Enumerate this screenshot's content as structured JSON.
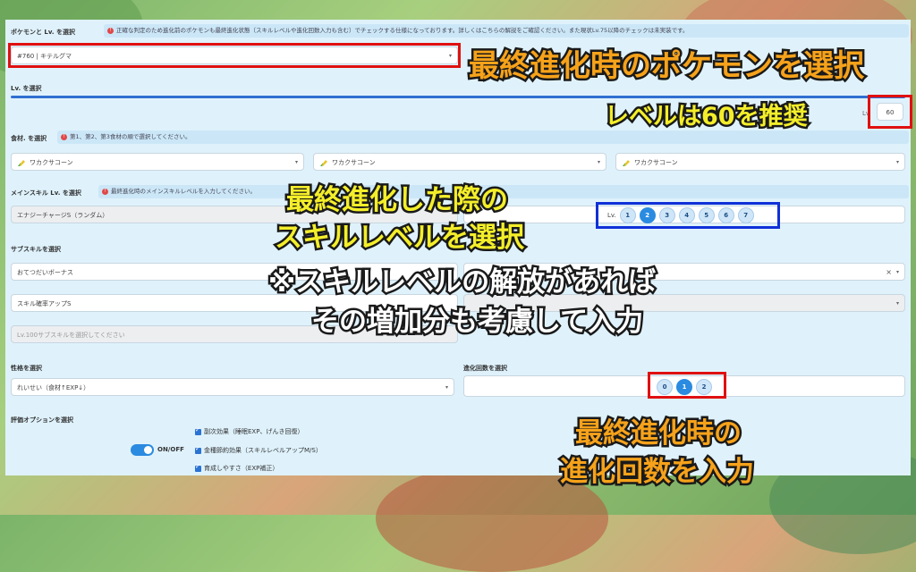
{
  "pokemon": {
    "label": "ポケモンと Lv. を選択",
    "note": "正確な判定のため進化前のポケモンも最終進化状態（スキルレベルや進化回数入力も含む）でチェックする仕様になっております。詳しくはこちらの解説をご確認ください。また現状Lv.75以降のチェックは未実装です。",
    "selected": "#760 | キテルグマ"
  },
  "level": {
    "label": "Lv. を選択",
    "prefix": "Lv.",
    "value": "60"
  },
  "ingredients": {
    "label": "食材. を選択",
    "note": "第1、第2、第3食材の順で選択してください。",
    "items": [
      "ワカクサコーン",
      "ワカクサコーン",
      "ワカクサコーン"
    ]
  },
  "main_skill": {
    "label": "メインスキル Lv. を選択",
    "note": "最終進化時のメインスキルレベルを入力してください。",
    "selected": "エナジーチャージS（ランダム）",
    "level_prefix": "Lv.",
    "levels": [
      "1",
      "2",
      "3",
      "4",
      "5",
      "6",
      "7"
    ],
    "selected_level": "2"
  },
  "sub_skills": {
    "label": "サブスキルを選択",
    "values": [
      "おてつだいボーナス",
      "スキル確率アップS"
    ],
    "placeholder": "Lv.100サブスキルを選択してください",
    "clear": "×"
  },
  "nature": {
    "label": "性格を選択",
    "selected": "れいせい（食材↑EXP↓）"
  },
  "evolution": {
    "label": "進化回数を選択",
    "options": [
      "0",
      "1",
      "2"
    ],
    "selected": "1"
  },
  "eval_options": {
    "label": "評価オプションを選択",
    "toggle_label": "ON/OFF",
    "checks": [
      "副次効果（睡眠EXP、げんき回復）",
      "金種節約効果（スキルレベルアップM/S）",
      "育成しやすさ（EXP補正）"
    ]
  },
  "overlays": {
    "pokemon": "最終進化時のポケモンを選択",
    "level": "レベルは60を推奨",
    "skill_line1": "最終進化した際の",
    "skill_line2": "スキルレベルを選択",
    "note_line1": "※スキルレベルの解放があれば",
    "note_line2": "その増加分も考慮して入力",
    "evo_line1": "最終進化時の",
    "evo_line2": "進化回数を入力"
  },
  "colors": {
    "accent": "#2a8be0",
    "highlight_red": "#e01010",
    "highlight_blue": "#1030d8",
    "overlay_orange": "#f6a21a",
    "overlay_yellow": "#f4ee2a"
  }
}
